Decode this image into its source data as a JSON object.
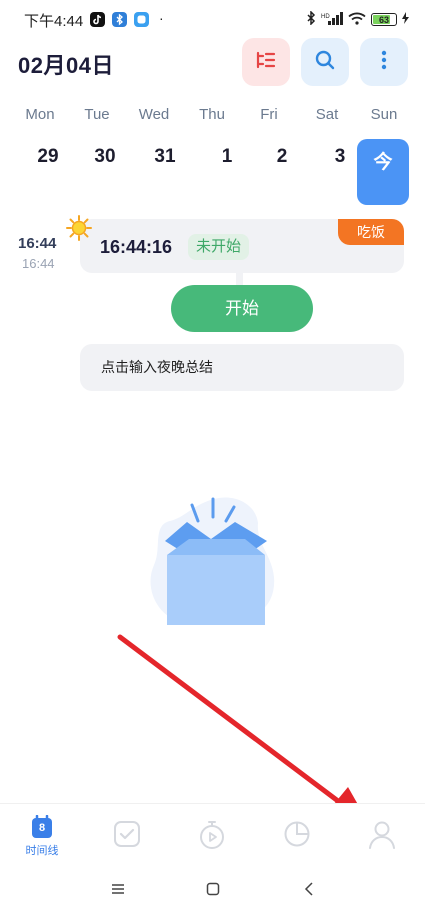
{
  "status_bar": {
    "time": "下午4:44",
    "dot": "·",
    "battery": "63"
  },
  "header": {
    "date": "02月04日"
  },
  "week": {
    "days": [
      "Mon",
      "Tue",
      "Wed",
      "Thu",
      "Fri",
      "Sat",
      "Sun"
    ],
    "dates": [
      "29",
      "30",
      "31",
      "1",
      "2",
      "3"
    ],
    "today_label": "今"
  },
  "timeline": {
    "time_main": "16:44",
    "time_sub": "16:44",
    "card_time": "16:44:16",
    "status": "未开始",
    "tag": "吃饭",
    "start_label": "开始",
    "summary_placeholder": "点击输入夜晚总结"
  },
  "nav": {
    "timeline_badge": "8",
    "timeline_label": "时间线"
  },
  "colors": {
    "accent": "#4b94f5",
    "green": "#47b97a",
    "orange": "#f37523"
  }
}
